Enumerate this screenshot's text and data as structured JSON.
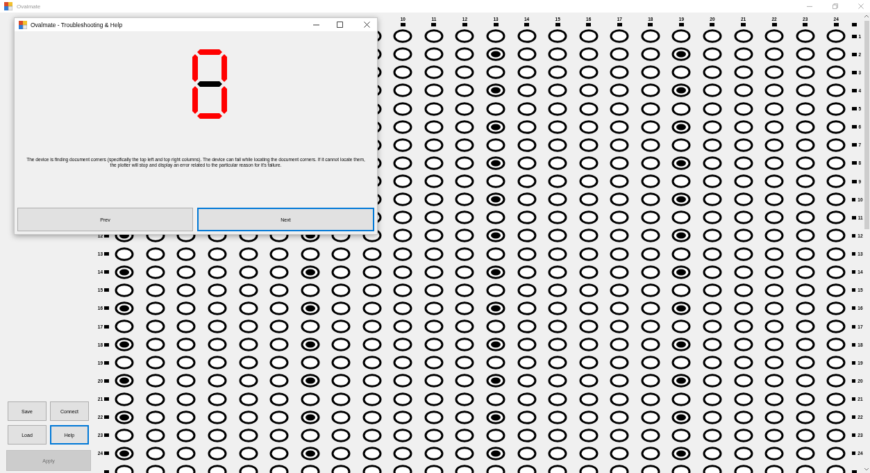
{
  "window": {
    "title": "Ovalmate"
  },
  "side_buttons": [
    {
      "label": "Save",
      "focused": false,
      "disabled": false
    },
    {
      "label": "Connect",
      "focused": false,
      "disabled": false
    },
    {
      "label": "Load",
      "focused": false,
      "disabled": false
    },
    {
      "label": "Help",
      "focused": true,
      "disabled": false
    }
  ],
  "apply_button": {
    "label": "Apply",
    "disabled": true
  },
  "grid": {
    "column_headers": [
      "10",
      "11",
      "12",
      "13",
      "14",
      "15",
      "16",
      "17",
      "18",
      "19",
      "20",
      "21",
      "22",
      "23",
      "24"
    ],
    "rows": [
      {
        "right_label": "1",
        "filled": [
          false,
          false,
          false,
          false,
          false,
          false,
          false,
          false,
          false,
          false,
          false,
          false,
          false,
          false,
          false
        ]
      },
      {
        "right_label": "2",
        "filled": [
          false,
          false,
          false,
          true,
          false,
          false,
          false,
          false,
          false,
          true,
          false,
          false,
          false,
          false,
          false
        ]
      },
      {
        "right_label": "3",
        "filled": [
          false,
          false,
          false,
          false,
          false,
          false,
          false,
          false,
          false,
          false,
          false,
          false,
          false,
          false,
          false
        ]
      },
      {
        "right_label": "4",
        "filled": [
          false,
          false,
          false,
          true,
          false,
          false,
          false,
          false,
          false,
          true,
          false,
          false,
          false,
          false,
          false
        ]
      },
      {
        "right_label": "5",
        "filled": [
          false,
          false,
          false,
          false,
          false,
          false,
          false,
          false,
          false,
          false,
          false,
          false,
          false,
          false,
          false
        ]
      },
      {
        "right_label": "6",
        "filled": [
          false,
          false,
          false,
          true,
          false,
          false,
          false,
          false,
          false,
          true,
          false,
          false,
          false,
          false,
          false
        ]
      },
      {
        "right_label": "7",
        "filled": [
          false,
          false,
          false,
          false,
          false,
          false,
          false,
          false,
          false,
          false,
          false,
          false,
          false,
          false,
          false
        ]
      },
      {
        "right_label": "8",
        "filled": [
          false,
          false,
          false,
          true,
          false,
          false,
          false,
          false,
          false,
          true,
          false,
          false,
          false,
          false,
          false
        ]
      },
      {
        "right_label": "9",
        "filled": [
          false,
          false,
          false,
          false,
          false,
          false,
          false,
          false,
          false,
          false,
          false,
          false,
          false,
          false,
          false
        ]
      },
      {
        "right_label": "10",
        "filled": [
          false,
          false,
          false,
          true,
          false,
          false,
          false,
          false,
          false,
          true,
          false,
          false,
          false,
          false,
          false
        ]
      },
      {
        "right_label": "11",
        "filled": [
          false,
          false,
          false,
          false,
          false,
          false,
          false,
          false,
          false,
          false,
          false,
          false,
          false,
          false,
          false
        ]
      },
      {
        "left_label": "12",
        "right_label": "12",
        "filled": [
          true,
          false,
          false,
          false,
          false,
          false,
          true,
          false,
          false,
          false,
          false,
          false,
          true,
          false,
          false,
          false,
          false,
          false,
          true,
          false,
          false,
          false,
          false,
          false
        ]
      },
      {
        "left_label": "13",
        "right_label": "13",
        "filled": [
          false,
          false,
          false,
          false,
          false,
          false,
          false,
          false,
          false,
          false,
          false,
          false,
          false,
          false,
          false,
          false,
          false,
          false,
          false,
          false,
          false,
          false,
          false,
          false
        ]
      },
      {
        "left_label": "14",
        "right_label": "14",
        "filled": [
          true,
          false,
          false,
          false,
          false,
          false,
          true,
          false,
          false,
          false,
          false,
          false,
          true,
          false,
          false,
          false,
          false,
          false,
          true,
          false,
          false,
          false,
          false,
          false
        ]
      },
      {
        "left_label": "15",
        "right_label": "15",
        "filled": [
          false,
          false,
          false,
          false,
          false,
          false,
          false,
          false,
          false,
          false,
          false,
          false,
          false,
          false,
          false,
          false,
          false,
          false,
          false,
          false,
          false,
          false,
          false,
          false
        ]
      },
      {
        "left_label": "16",
        "right_label": "16",
        "filled": [
          true,
          false,
          false,
          false,
          false,
          false,
          true,
          false,
          false,
          false,
          false,
          false,
          true,
          false,
          false,
          false,
          false,
          false,
          true,
          false,
          false,
          false,
          false,
          false
        ]
      },
      {
        "left_label": "17",
        "right_label": "17",
        "filled": [
          false,
          false,
          false,
          false,
          false,
          false,
          false,
          false,
          false,
          false,
          false,
          false,
          false,
          false,
          false,
          false,
          false,
          false,
          false,
          false,
          false,
          false,
          false,
          false
        ]
      },
      {
        "left_label": "18",
        "right_label": "18",
        "filled": [
          true,
          false,
          false,
          false,
          false,
          false,
          true,
          false,
          false,
          false,
          false,
          false,
          true,
          false,
          false,
          false,
          false,
          false,
          true,
          false,
          false,
          false,
          false,
          false
        ]
      },
      {
        "left_label": "19",
        "right_label": "19",
        "filled": [
          false,
          false,
          false,
          false,
          false,
          false,
          false,
          false,
          false,
          false,
          false,
          false,
          false,
          false,
          false,
          false,
          false,
          false,
          false,
          false,
          false,
          false,
          false,
          false
        ]
      },
      {
        "left_label": "20",
        "right_label": "20",
        "filled": [
          true,
          false,
          false,
          false,
          false,
          false,
          true,
          false,
          false,
          false,
          false,
          false,
          true,
          false,
          false,
          false,
          false,
          false,
          true,
          false,
          false,
          false,
          false,
          false
        ]
      },
      {
        "left_label": "21",
        "right_label": "21",
        "filled": [
          false,
          false,
          false,
          false,
          false,
          false,
          false,
          false,
          false,
          false,
          false,
          false,
          false,
          false,
          false,
          false,
          false,
          false,
          false,
          false,
          false,
          false,
          false,
          false
        ]
      },
      {
        "left_label": "22",
        "right_label": "22",
        "filled": [
          true,
          false,
          false,
          false,
          false,
          false,
          true,
          false,
          false,
          false,
          false,
          false,
          true,
          false,
          false,
          false,
          false,
          false,
          true,
          false,
          false,
          false,
          false,
          false
        ]
      },
      {
        "left_label": "23",
        "right_label": "23",
        "filled": [
          false,
          false,
          false,
          false,
          false,
          false,
          false,
          false,
          false,
          false,
          false,
          false,
          false,
          false,
          false,
          false,
          false,
          false,
          false,
          false,
          false,
          false,
          false,
          false
        ]
      },
      {
        "left_label": "24",
        "right_label": "24",
        "filled": [
          true,
          false,
          false,
          false,
          false,
          false,
          true,
          false,
          false,
          false,
          false,
          false,
          true,
          false,
          false,
          false,
          false,
          false,
          true,
          false,
          false,
          false,
          false,
          false
        ]
      },
      {
        "filled": [
          false,
          false,
          false,
          false,
          false,
          false,
          false,
          false,
          false,
          false,
          false,
          false,
          false,
          false,
          false,
          false,
          false,
          false,
          false,
          false,
          false,
          false,
          false,
          false
        ]
      }
    ]
  },
  "dialog": {
    "title": "Ovalmate - Troubleshooting & Help",
    "segments": [
      {
        "on": true
      },
      {
        "on": true
      },
      {
        "on": true
      },
      {
        "on": true
      },
      {
        "on": true
      },
      {
        "on": true
      },
      {
        "on": false
      }
    ],
    "description": "The device is finding document corners (specifically the top left and top right columns). The device can fail while locating the document corners. If it cannot locate them, the plotter will stop and display an error related to the particular reason for it's failure.",
    "buttons": [
      {
        "label": "Prev",
        "focused": false
      },
      {
        "label": "Next",
        "focused": true
      }
    ]
  }
}
